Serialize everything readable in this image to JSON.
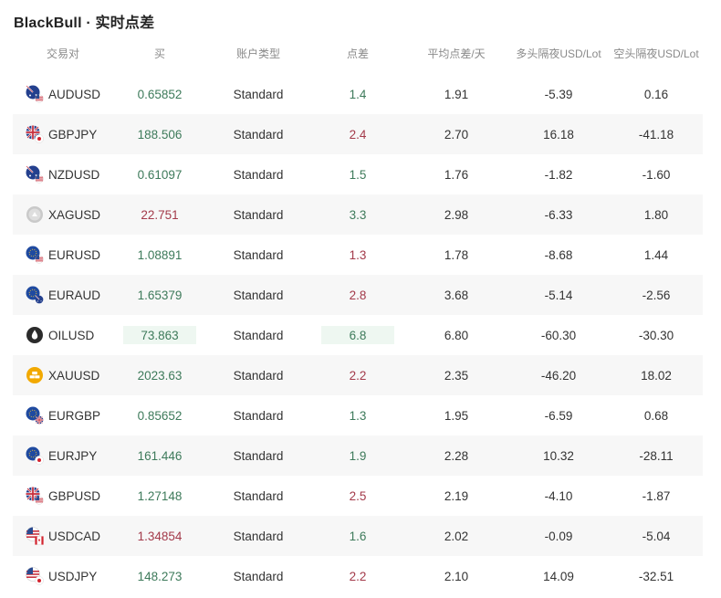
{
  "title": "BlackBull · 实时点差",
  "headers": [
    "交易对",
    "买",
    "账户类型",
    "点差",
    "平均点差/天",
    "多头隔夜USD/Lot",
    "空头隔夜USD/Lot"
  ],
  "rows": [
    {
      "pair": "AUDUSD",
      "buy": "0.65852",
      "buy_dir": "up",
      "type": "Standard",
      "spread": "1.4",
      "spread_dir": "up",
      "avg": "1.91",
      "long": "-5.39",
      "short": "0.16",
      "icon": "aud-usd-flag-icon"
    },
    {
      "pair": "GBPJPY",
      "buy": "188.506",
      "buy_dir": "up",
      "type": "Standard",
      "spread": "2.4",
      "spread_dir": "down",
      "avg": "2.70",
      "long": "16.18",
      "short": "-41.18",
      "icon": "gbp-jpy-flag-icon"
    },
    {
      "pair": "NZDUSD",
      "buy": "0.61097",
      "buy_dir": "up",
      "type": "Standard",
      "spread": "1.5",
      "spread_dir": "up",
      "avg": "1.76",
      "long": "-1.82",
      "short": "-1.60",
      "icon": "nzd-usd-flag-icon"
    },
    {
      "pair": "XAGUSD",
      "buy": "22.751",
      "buy_dir": "down",
      "type": "Standard",
      "spread": "3.3",
      "spread_dir": "up",
      "avg": "2.98",
      "long": "-6.33",
      "short": "1.80",
      "icon": "silver-icon"
    },
    {
      "pair": "EURUSD",
      "buy": "1.08891",
      "buy_dir": "up",
      "type": "Standard",
      "spread": "1.3",
      "spread_dir": "down",
      "avg": "1.78",
      "long": "-8.68",
      "short": "1.44",
      "icon": "eur-usd-flag-icon"
    },
    {
      "pair": "EURAUD",
      "buy": "1.65379",
      "buy_dir": "up",
      "type": "Standard",
      "spread": "2.8",
      "spread_dir": "down",
      "avg": "3.68",
      "long": "-5.14",
      "short": "-2.56",
      "icon": "eur-aud-flag-icon"
    },
    {
      "pair": "OILUSD",
      "buy": "73.863",
      "buy_dir": "up",
      "buy_highlight": true,
      "type": "Standard",
      "spread": "6.8",
      "spread_dir": "up",
      "spread_highlight": true,
      "avg": "6.80",
      "long": "-60.30",
      "short": "-30.30",
      "icon": "oil-drop-icon"
    },
    {
      "pair": "XAUUSD",
      "buy": "2023.63",
      "buy_dir": "up",
      "type": "Standard",
      "spread": "2.2",
      "spread_dir": "down",
      "avg": "2.35",
      "long": "-46.20",
      "short": "18.02",
      "icon": "gold-icon"
    },
    {
      "pair": "EURGBP",
      "buy": "0.85652",
      "buy_dir": "up",
      "type": "Standard",
      "spread": "1.3",
      "spread_dir": "up",
      "avg": "1.95",
      "long": "-6.59",
      "short": "0.68",
      "icon": "eur-gbp-flag-icon"
    },
    {
      "pair": "EURJPY",
      "buy": "161.446",
      "buy_dir": "up",
      "type": "Standard",
      "spread": "1.9",
      "spread_dir": "up",
      "avg": "2.28",
      "long": "10.32",
      "short": "-28.11",
      "icon": "eur-jpy-flag-icon"
    },
    {
      "pair": "GBPUSD",
      "buy": "1.27148",
      "buy_dir": "up",
      "type": "Standard",
      "spread": "2.5",
      "spread_dir": "down",
      "avg": "2.19",
      "long": "-4.10",
      "short": "-1.87",
      "icon": "gbp-usd-flag-icon"
    },
    {
      "pair": "USDCAD",
      "buy": "1.34854",
      "buy_dir": "down",
      "type": "Standard",
      "spread": "1.6",
      "spread_dir": "up",
      "avg": "2.02",
      "long": "-0.09",
      "short": "-5.04",
      "icon": "usd-cad-flag-icon"
    },
    {
      "pair": "USDJPY",
      "buy": "148.273",
      "buy_dir": "up",
      "type": "Standard",
      "spread": "2.2",
      "spread_dir": "down",
      "avg": "2.10",
      "long": "14.09",
      "short": "-32.51",
      "icon": "usd-jpy-flag-icon"
    }
  ],
  "colors": {
    "up": "#3d7a5a",
    "down": "#a33a4a",
    "highlight": "#eef7f1",
    "alt_row": "#f7f7f7"
  }
}
